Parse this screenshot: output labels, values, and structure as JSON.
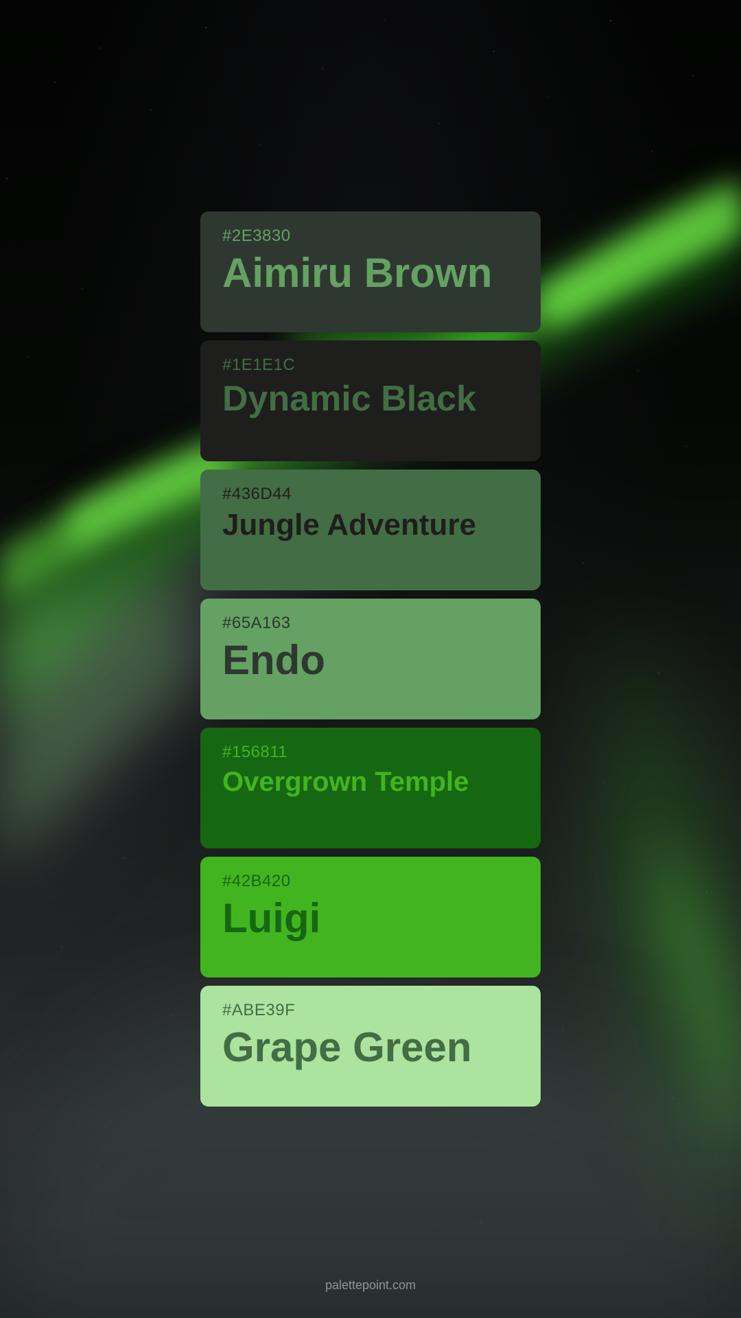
{
  "swatches": [
    {
      "hex": "#2E3830",
      "name": "Aimiru Brown",
      "background": "#2E3830",
      "text_color": "#65A163"
    },
    {
      "hex": "#1E1E1C",
      "name": "Dynamic Black",
      "background": "#1E1E1C",
      "text_color": "#436D44"
    },
    {
      "hex": "#436D44",
      "name": "Jungle Adventure",
      "background": "#436D44",
      "text_color": "#1E1E1C"
    },
    {
      "hex": "#65A163",
      "name": "Endo",
      "background": "#65A163",
      "text_color": "#2E3830"
    },
    {
      "hex": "#156811",
      "name": "Overgrown Temple",
      "background": "#156811",
      "text_color": "#42B420"
    },
    {
      "hex": "#42B420",
      "name": "Luigi",
      "background": "#42B420",
      "text_color": "#156811"
    },
    {
      "hex": "#ABE39F",
      "name": "Grape Green",
      "background": "#ABE39F",
      "text_color": "#436D44"
    }
  ],
  "footer": {
    "site": "palettepoint.com"
  },
  "background": {
    "aurora_color": "#42B420"
  }
}
